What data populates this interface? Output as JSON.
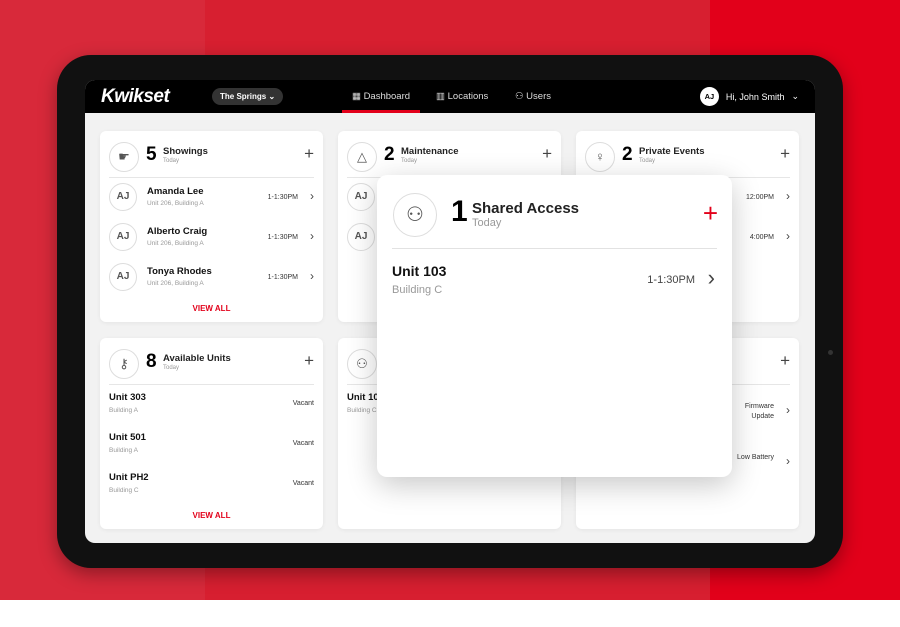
{
  "header": {
    "logo": "Kwikset",
    "location": "The Springs",
    "nav": [
      {
        "label": "Dashboard",
        "icon": "grid-icon",
        "active": true
      },
      {
        "label": "Locations",
        "icon": "building-icon"
      },
      {
        "label": "Users",
        "icon": "users-icon"
      }
    ],
    "user_initials": "AJ",
    "greeting": "Hi, John Smith"
  },
  "accent": "#e2001a",
  "cards": {
    "showings": {
      "count": "5",
      "title": "Showings",
      "sub": "Today",
      "items": [
        {
          "initials": "AJ",
          "name": "Amanda Lee",
          "detail": "Unit 206, Building A",
          "time": "1-1:30PM"
        },
        {
          "initials": "AJ",
          "name": "Alberto Craig",
          "detail": "Unit 206, Building A",
          "time": "1-1:30PM"
        },
        {
          "initials": "AJ",
          "name": "Tonya Rhodes",
          "detail": "Unit 206, Building A",
          "time": "1-1:30PM"
        }
      ],
      "view_all": "VIEW ALL"
    },
    "maintenance": {
      "count": "2",
      "title": "Maintenance",
      "sub": "Today",
      "items": [
        {
          "initials": "AJ"
        },
        {
          "initials": "AJ"
        }
      ]
    },
    "events": {
      "count": "2",
      "title": "Private Events",
      "sub": "Today",
      "items": [
        {
          "time": "12:00PM"
        },
        {
          "time": "4:00PM"
        }
      ]
    },
    "units": {
      "count": "8",
      "title": "Available Units",
      "sub": "Today",
      "items": [
        {
          "name": "Unit 303",
          "detail": "Building A",
          "status": "Vacant"
        },
        {
          "name": "Unit 501",
          "detail": "Building A",
          "status": "Vacant"
        },
        {
          "name": "Unit PH2",
          "detail": "Building C",
          "status": "Vacant"
        }
      ],
      "view_all": "VIEW ALL"
    },
    "shared_bg": {
      "item_name": "Unit 10",
      "item_detail": "Building C"
    },
    "alerts": {
      "items": [
        {
          "status": "Firmware Update"
        },
        {
          "status": "Low Battery"
        }
      ]
    }
  },
  "popup": {
    "count": "1",
    "title": "Shared Access",
    "sub": "Today",
    "item": {
      "name": "Unit 103",
      "detail": "Building C",
      "time": "1-1:30PM"
    }
  }
}
